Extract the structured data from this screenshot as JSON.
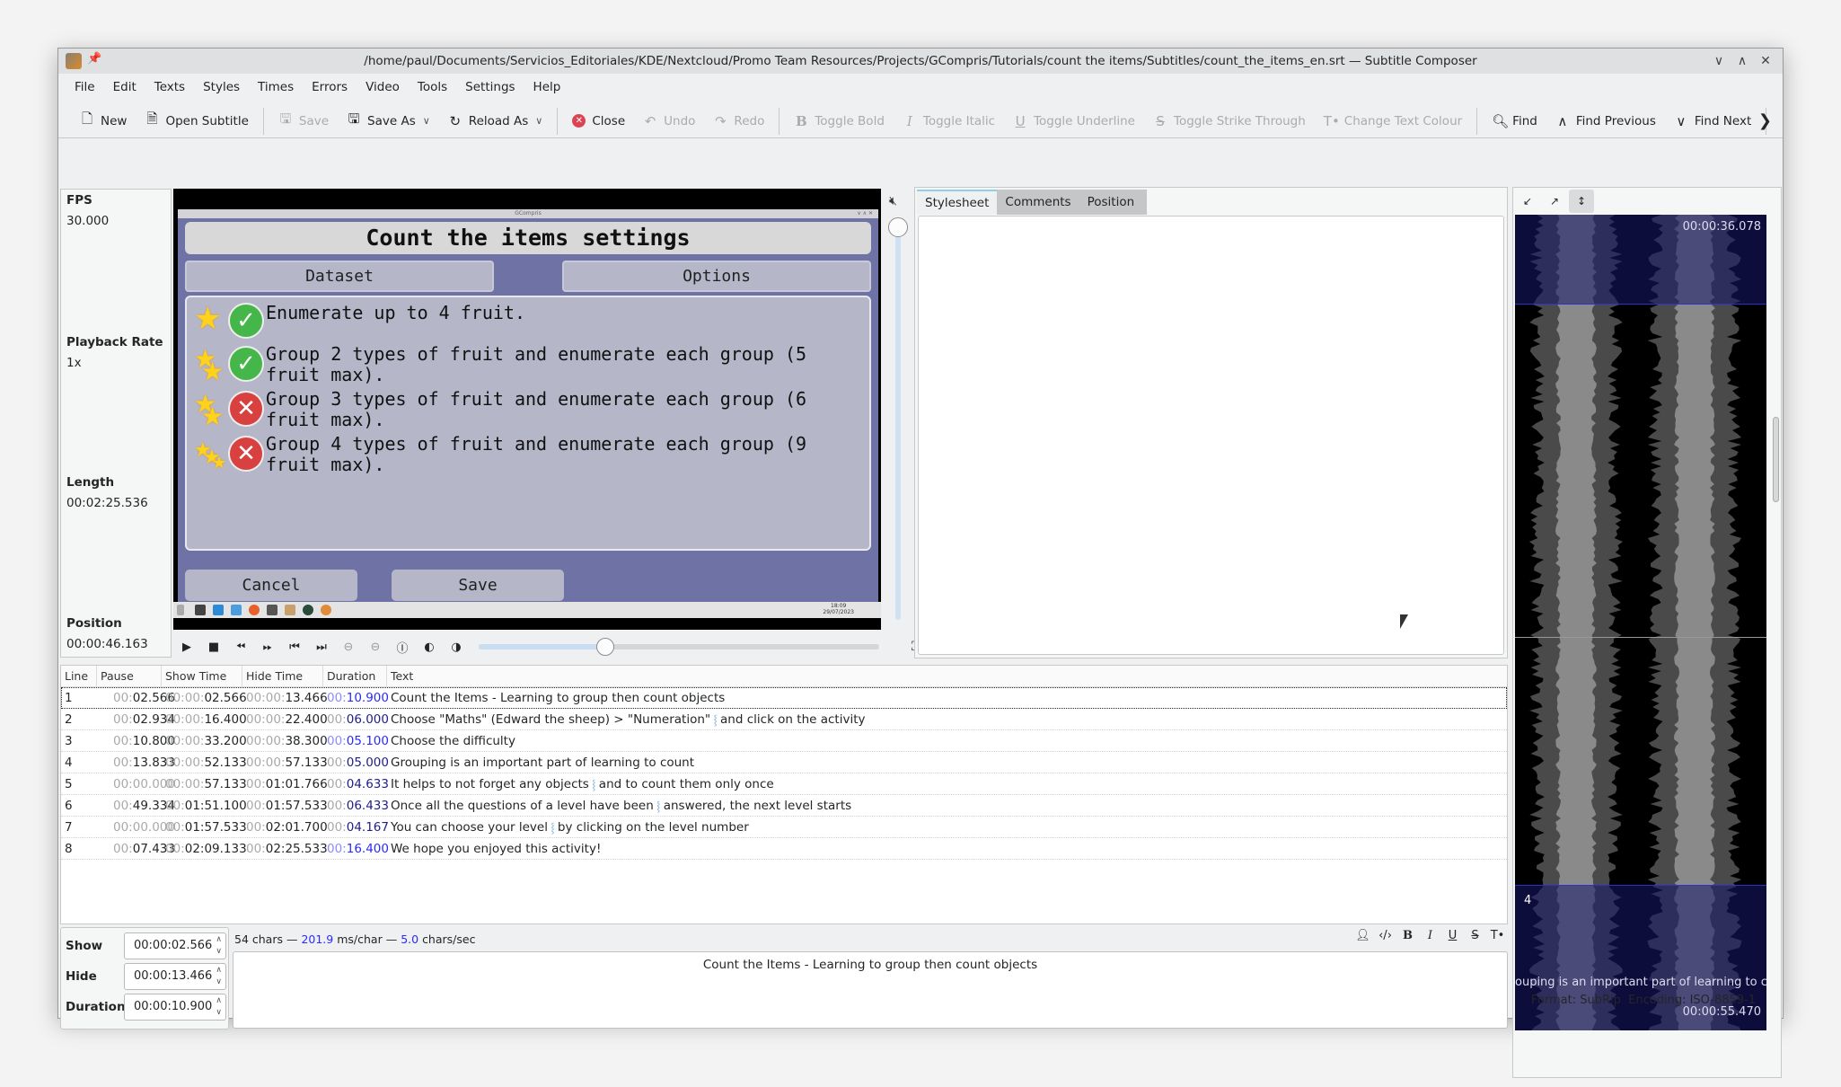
{
  "window": {
    "title": "/home/paul/Documents/Servicios_Editoriales/KDE/Nextcloud/Promo Team Resources/Projects/GCompris/Tutorials/count the items/Subtitles/count_the_items_en.srt — Subtitle Composer",
    "controls": [
      "minimize",
      "maximize",
      "close"
    ]
  },
  "menu": [
    "File",
    "Edit",
    "Texts",
    "Styles",
    "Times",
    "Errors",
    "Video",
    "Tools",
    "Settings",
    "Help"
  ],
  "toolbar": {
    "new": "New",
    "open": "Open Subtitle",
    "save": "Save",
    "save_as": "Save As",
    "reload_as": "Reload As",
    "close": "Close",
    "undo": "Undo",
    "redo": "Redo",
    "toggle_bold": "Toggle Bold",
    "toggle_italic": "Toggle Italic",
    "toggle_underline": "Toggle Underline",
    "toggle_strike": "Toggle Strike Through",
    "change_colour": "Change Text Colour",
    "find": "Find",
    "find_prev": "Find Previous",
    "find_next": "Find Next"
  },
  "info": {
    "fps_label": "FPS",
    "fps": "30.000",
    "rate_label": "Playback Rate",
    "rate": "1x",
    "length_label": "Length",
    "length": "00:02:25.536",
    "position_label": "Position",
    "position": "00:00:46.163"
  },
  "video": {
    "window_title": "GCompris",
    "heading": "Count the items settings",
    "tab_dataset": "Dataset",
    "tab_options": "Options",
    "items": [
      {
        "text": "Enumerate up to 4 fruit.",
        "enabled": true,
        "stars": 1
      },
      {
        "text": "Group 2 types of fruit and enumerate each group (5 fruit max).",
        "enabled": true,
        "stars": 2
      },
      {
        "text": "Group 3 types of fruit and enumerate each group (6 fruit max).",
        "enabled": false,
        "stars": 2
      },
      {
        "text": "Group 4 types of fruit and enumerate each group (9 fruit max).",
        "enabled": false,
        "stars": 3
      }
    ],
    "cancel": "Cancel",
    "save": "Save",
    "clock_time": "18:09",
    "clock_date": "29/07/2023",
    "seek_fraction": 0.317,
    "volume_fraction": 1.0,
    "muted": true
  },
  "tabs": [
    "Stylesheet",
    "Comments",
    "Position"
  ],
  "active_tab": "Stylesheet",
  "waveform": {
    "top_time": "00:00:36.078",
    "bottom_time": "00:00:55.470",
    "block_line": "4",
    "block_text": "ouping is an important part of learning to cou"
  },
  "table": {
    "headers": [
      "Line",
      "Pause",
      "Show Time",
      "Hide Time",
      "Duration",
      "Text"
    ],
    "rows": [
      {
        "line": "1",
        "pause_a": "00:",
        "pause_b": "02.566",
        "show_a": "00:00:",
        "show_b": "02.566",
        "hide_a": "00:00:",
        "hide_b": "13.466",
        "dur_a": "00:",
        "dur_b": "10.900",
        "dur_long": true,
        "text": [
          "Count the Items - Learning to group then count objects"
        ]
      },
      {
        "line": "2",
        "pause_a": "00:",
        "pause_b": "02.934",
        "show_a": "00:00:",
        "show_b": "16.400",
        "hide_a": "00:00:",
        "hide_b": "22.400",
        "dur_a": "00:",
        "dur_b": "06.000",
        "dur_long": false,
        "text": [
          "Choose \"Maths\" (Edward the sheep) > \"Numeration\"",
          "and click on the activity"
        ]
      },
      {
        "line": "3",
        "pause_a": "00:",
        "pause_b": "10.800",
        "show_a": "00:00:",
        "show_b": "33.200",
        "hide_a": "00:00:",
        "hide_b": "38.300",
        "dur_a": "00:",
        "dur_b": "05.100",
        "dur_long": true,
        "text": [
          "Choose the difficulty"
        ]
      },
      {
        "line": "4",
        "pause_a": "00:",
        "pause_b": "13.833",
        "show_a": "00:00:",
        "show_b": "52.133",
        "hide_a": "00:00:",
        "hide_b": "57.133",
        "dur_a": "00:",
        "dur_b": "05.000",
        "dur_long": false,
        "text": [
          "Grouping is an important part of learning to count"
        ]
      },
      {
        "line": "5",
        "pause_a": "00:00.000",
        "pause_b": "",
        "show_a": "00:00:",
        "show_b": "57.133",
        "hide_a": "00:",
        "hide_b": "01:01.766",
        "dur_a": "00:",
        "dur_b": "04.633",
        "dur_long": false,
        "text": [
          "It helps to not forget any objects",
          "and to count them only once"
        ]
      },
      {
        "line": "6",
        "pause_a": "00:",
        "pause_b": "49.334",
        "show_a": "00:",
        "show_b": "01:51.100",
        "hide_a": "00:",
        "hide_b": "01:57.533",
        "dur_a": "00:",
        "dur_b": "06.433",
        "dur_long": false,
        "text": [
          "Once all the questions of a level have been",
          "answered, the next level starts"
        ]
      },
      {
        "line": "7",
        "pause_a": "00:00.000",
        "pause_b": "",
        "show_a": "00:",
        "show_b": "01:57.533",
        "hide_a": "00:",
        "hide_b": "02:01.700",
        "dur_a": "00:",
        "dur_b": "04.167",
        "dur_long": false,
        "text": [
          "You can choose your level",
          "by clicking on the level number"
        ]
      },
      {
        "line": "8",
        "pause_a": "00:",
        "pause_b": "07.433",
        "show_a": "00:",
        "show_b": "02:09.133",
        "hide_a": "00:",
        "hide_b": "02:25.533",
        "dur_a": "00:",
        "dur_b": "16.400",
        "dur_long": true,
        "text": [
          "We hope you enjoyed this activity!"
        ]
      }
    ],
    "selected_row": 0
  },
  "editor": {
    "show_label": "Show",
    "show": "00:00:02.566",
    "hide_label": "Hide",
    "hide": "00:00:13.466",
    "duration_label": "Duration",
    "duration": "00:00:10.900",
    "chars": "54 chars —",
    "ms_per_char": "201.9",
    "ms_unit": "ms/char —",
    "chars_per_sec": "5.0",
    "cps_unit": "chars/sec",
    "text": "Count the Items - Learning to group then count objects"
  },
  "status": {
    "format": "Format: SubRip",
    "encoding": "Encoding: ISO-8859-1"
  }
}
